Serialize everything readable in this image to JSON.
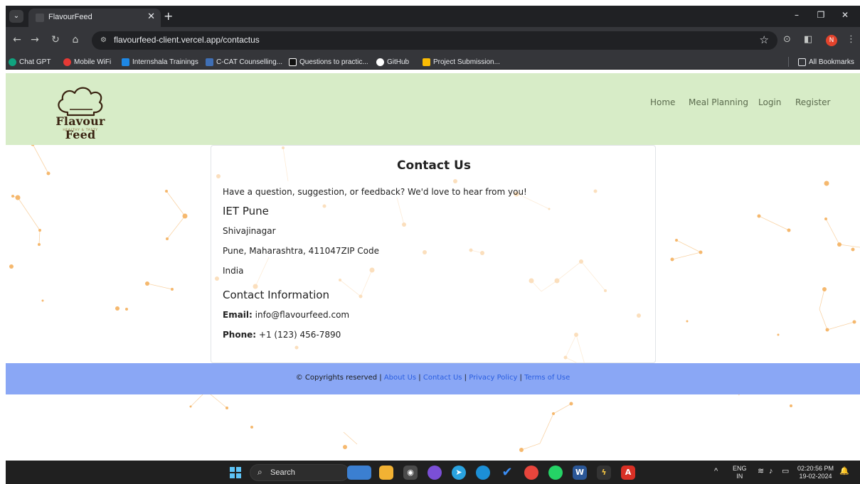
{
  "browser": {
    "tab_title": "FlavourFeed",
    "url": "flavourfeed-client.vercel.app/contactus",
    "profile_initial": "N",
    "bookmarks": [
      "Chat GPT",
      "Mobile WiFi",
      "Internshala Trainings",
      "C-CAT Counselling...",
      "Questions to practic...",
      "GitHub",
      "Project Submission..."
    ],
    "all_bookmarks": "All Bookmarks"
  },
  "header": {
    "logo_text": "Flavour Feed",
    "logo_tagline": "HEALTHY & TASTY",
    "nav": [
      "Home",
      "Meal Planning",
      "Login",
      "Register"
    ]
  },
  "contact": {
    "title": "Contact Us",
    "intro": "Have a question, suggestion, or feedback? We'd love to hear from you!",
    "org_heading": "IET Pune",
    "address_lines": [
      "Shivajinagar",
      "Pune, Maharashtra, 411047ZIP Code",
      "India"
    ],
    "info_heading": "Contact Information",
    "email_label": "Email:",
    "email_value": "info@flavourfeed.com",
    "phone_label": "Phone:",
    "phone_value": "+1 (123) 456-7890"
  },
  "footer": {
    "copyright": "© Copyrights reserved",
    "links": [
      "About Us",
      "Contact Us",
      "Privacy Policy",
      "Terms of Use"
    ]
  },
  "taskbar": {
    "search_label": "Search",
    "lang_top": "ENG",
    "lang_bottom": "IN",
    "time": "02:20:56 PM",
    "date": "19-02-2024"
  },
  "colors": {
    "header_bg": "#d7ecc7",
    "footer_bg": "#8aa7f5",
    "link": "#2a5ee0",
    "particles": "#f5b567"
  }
}
